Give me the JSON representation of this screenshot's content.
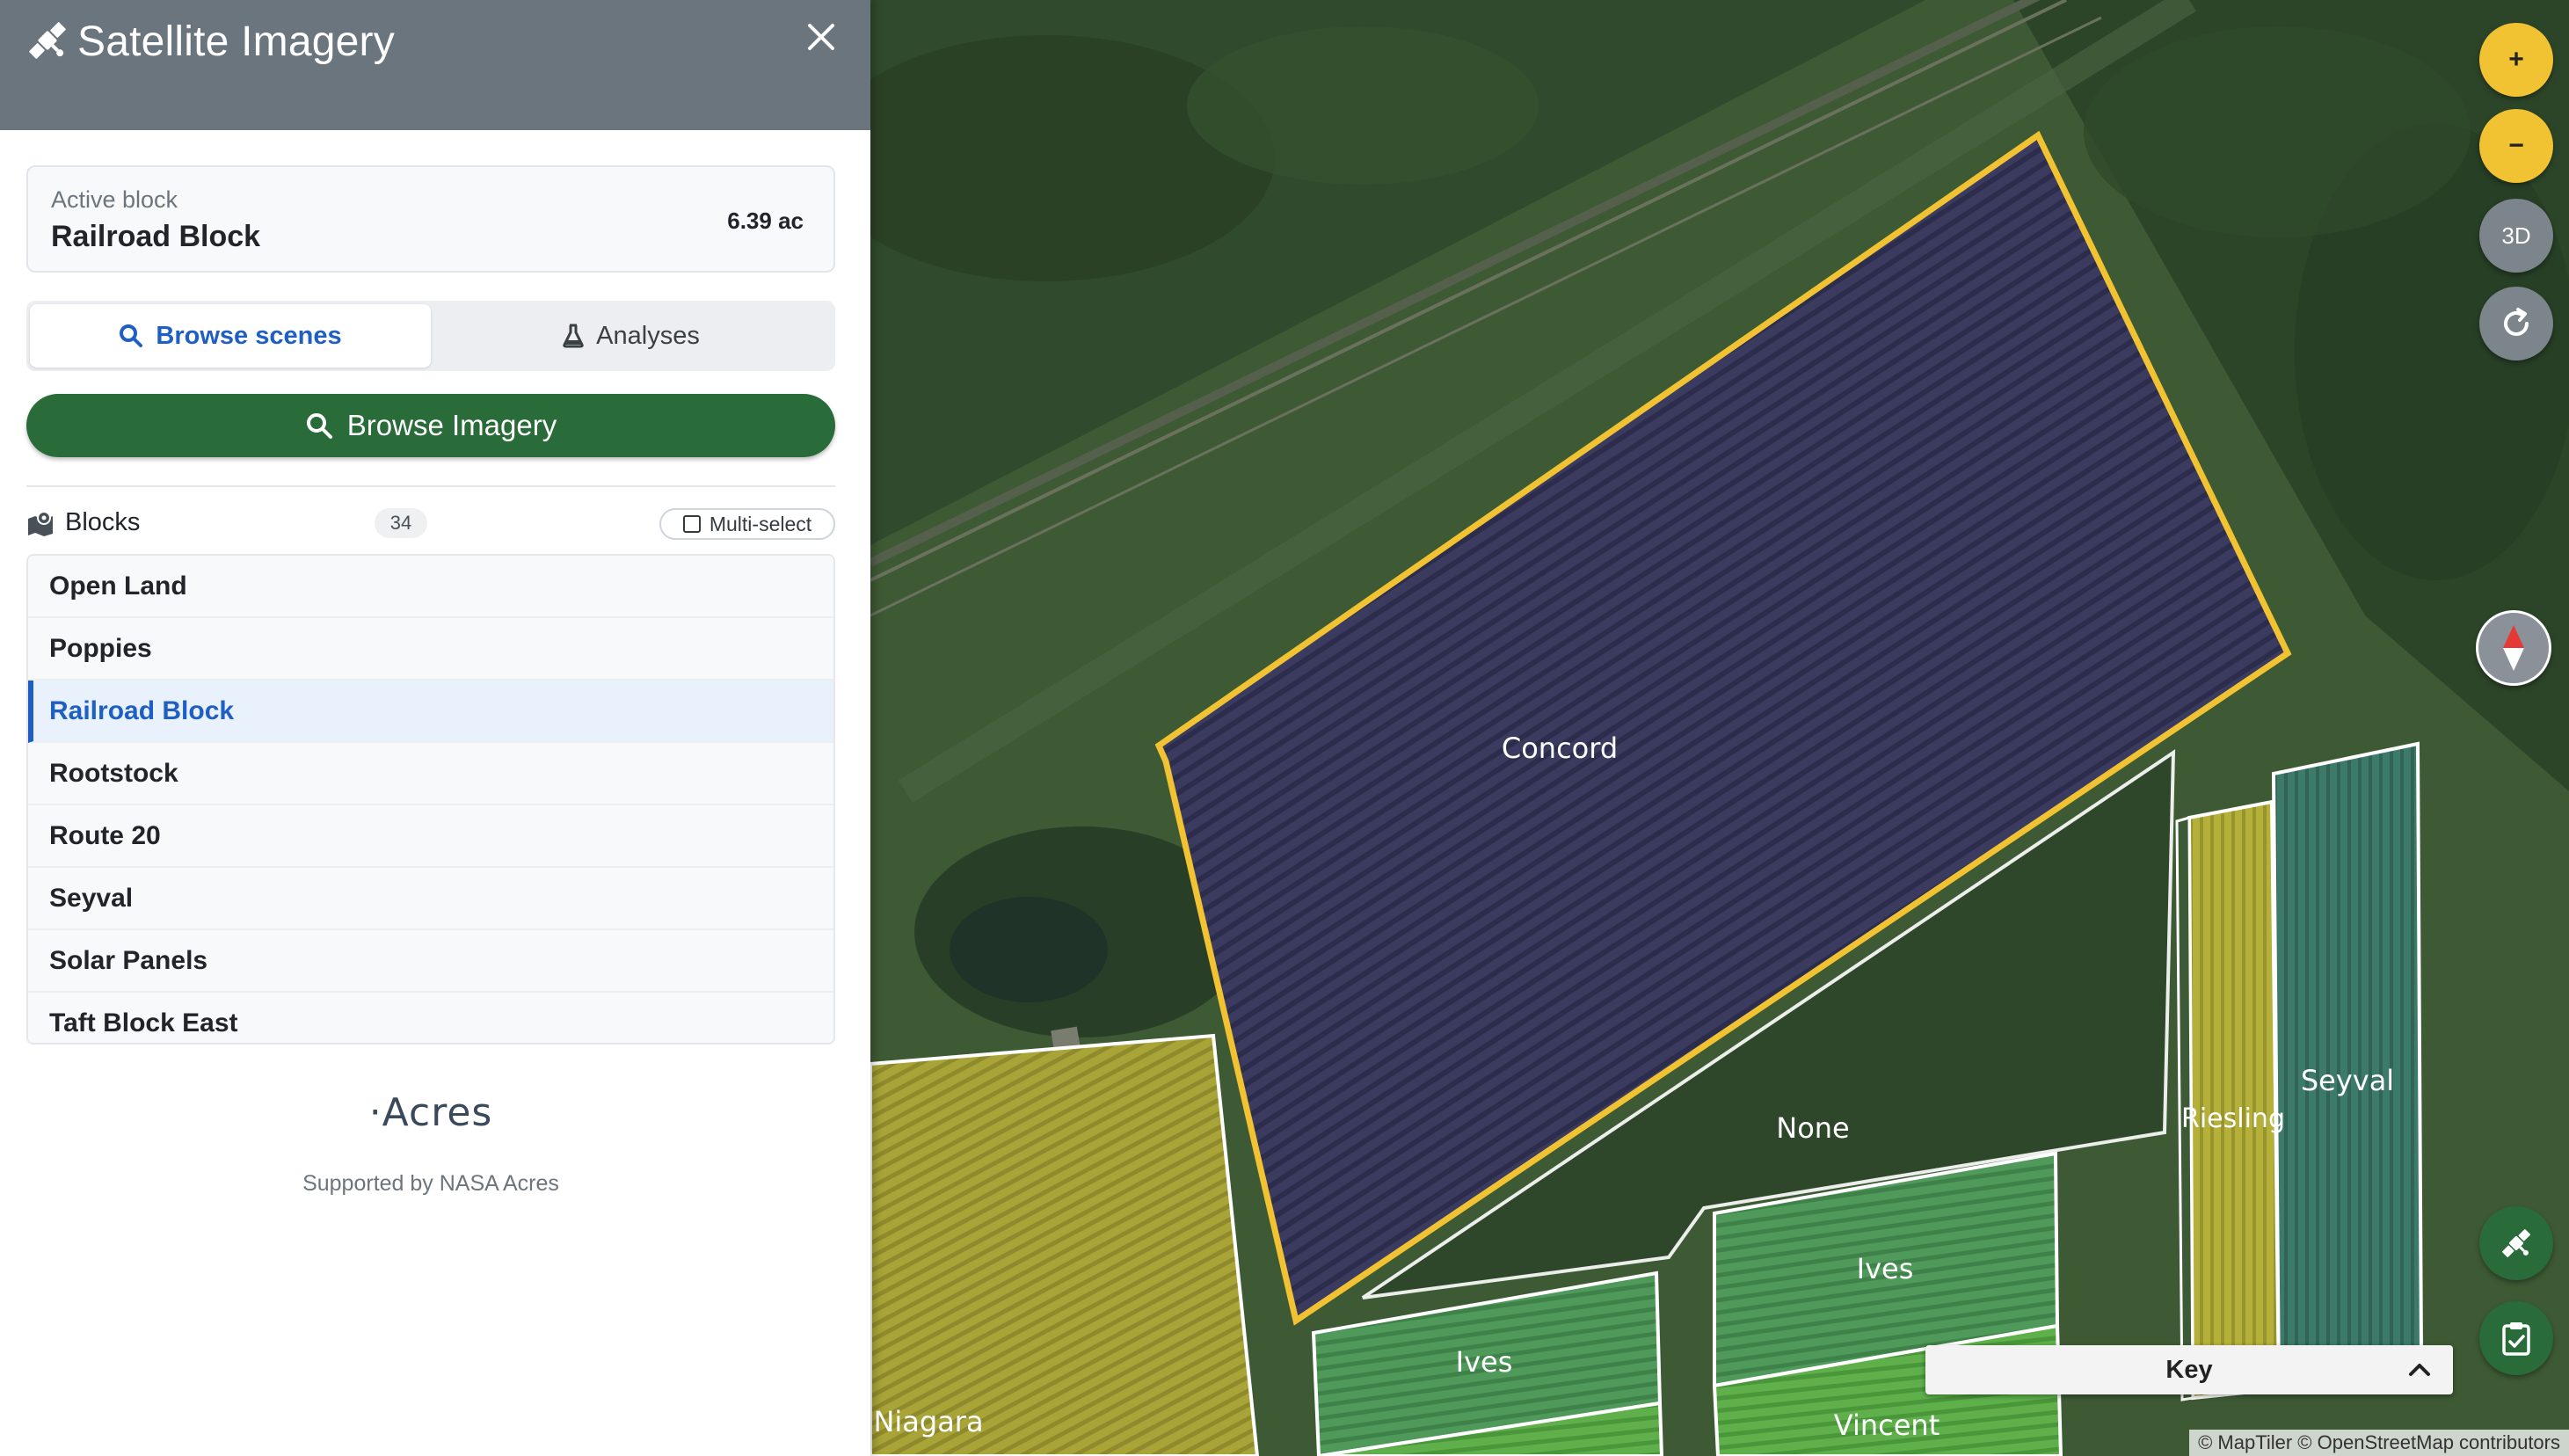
{
  "sidebar": {
    "title": "Satellite Imagery",
    "active_block": {
      "label": "Active block",
      "name": "Railroad Block",
      "area": "6.39 ac"
    },
    "tabs": [
      {
        "label": "Browse scenes",
        "active": true
      },
      {
        "label": "Analyses",
        "active": false
      }
    ],
    "browse_button": "Browse Imagery",
    "blocks": {
      "label": "Blocks",
      "count": "34",
      "multi_select": "Multi-select",
      "items": [
        {
          "name": "Open Land"
        },
        {
          "name": "Poppies"
        },
        {
          "name": "Railroad Block",
          "selected": true
        },
        {
          "name": "Rootstock"
        },
        {
          "name": "Route 20"
        },
        {
          "name": "Seyval"
        },
        {
          "name": "Solar Panels"
        },
        {
          "name": "Taft Block East"
        }
      ]
    },
    "logo_text": "·Acres",
    "supported_by": "Supported by NASA Acres"
  },
  "map": {
    "controls": {
      "zoom_in": "+",
      "zoom_out": "−",
      "three_d": "3D"
    },
    "field_labels": {
      "concord": "Concord",
      "none": "None",
      "riesling": "Riesling",
      "seyval": "Seyval",
      "ives_1": "Ives",
      "ives_2": "Ives",
      "vincent": "Vincent",
      "niagara": "Niagara"
    },
    "key_label": "Key",
    "attribution": "© MapTiler © OpenStreetMap contributors"
  },
  "colors": {
    "accent_blue": "#1f5fc4",
    "primary_green": "#2a6b3a",
    "header_grey": "#6b757e",
    "selected_outline": "#f1c232"
  }
}
